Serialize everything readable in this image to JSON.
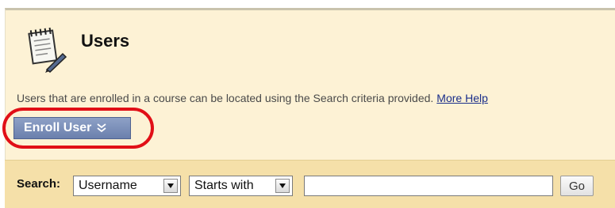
{
  "header": {
    "title": "Users",
    "icon": "notepad-icon"
  },
  "description": {
    "text": "Users that are enrolled in a course can be located using the Search criteria provided.",
    "help_link": "More Help"
  },
  "actions": {
    "enroll_label": "Enroll User",
    "enroll_icon": "double-chevron-down-icon",
    "highlight_color": "#e10f17"
  },
  "search": {
    "label": "Search:",
    "field_select": "Username",
    "operator_select": "Starts with",
    "query_value": "",
    "go_label": "Go"
  },
  "colors": {
    "panel_bg": "#fdf2d5",
    "search_bar_bg": "#f5e0a9",
    "button_bg": "#7386b3"
  }
}
